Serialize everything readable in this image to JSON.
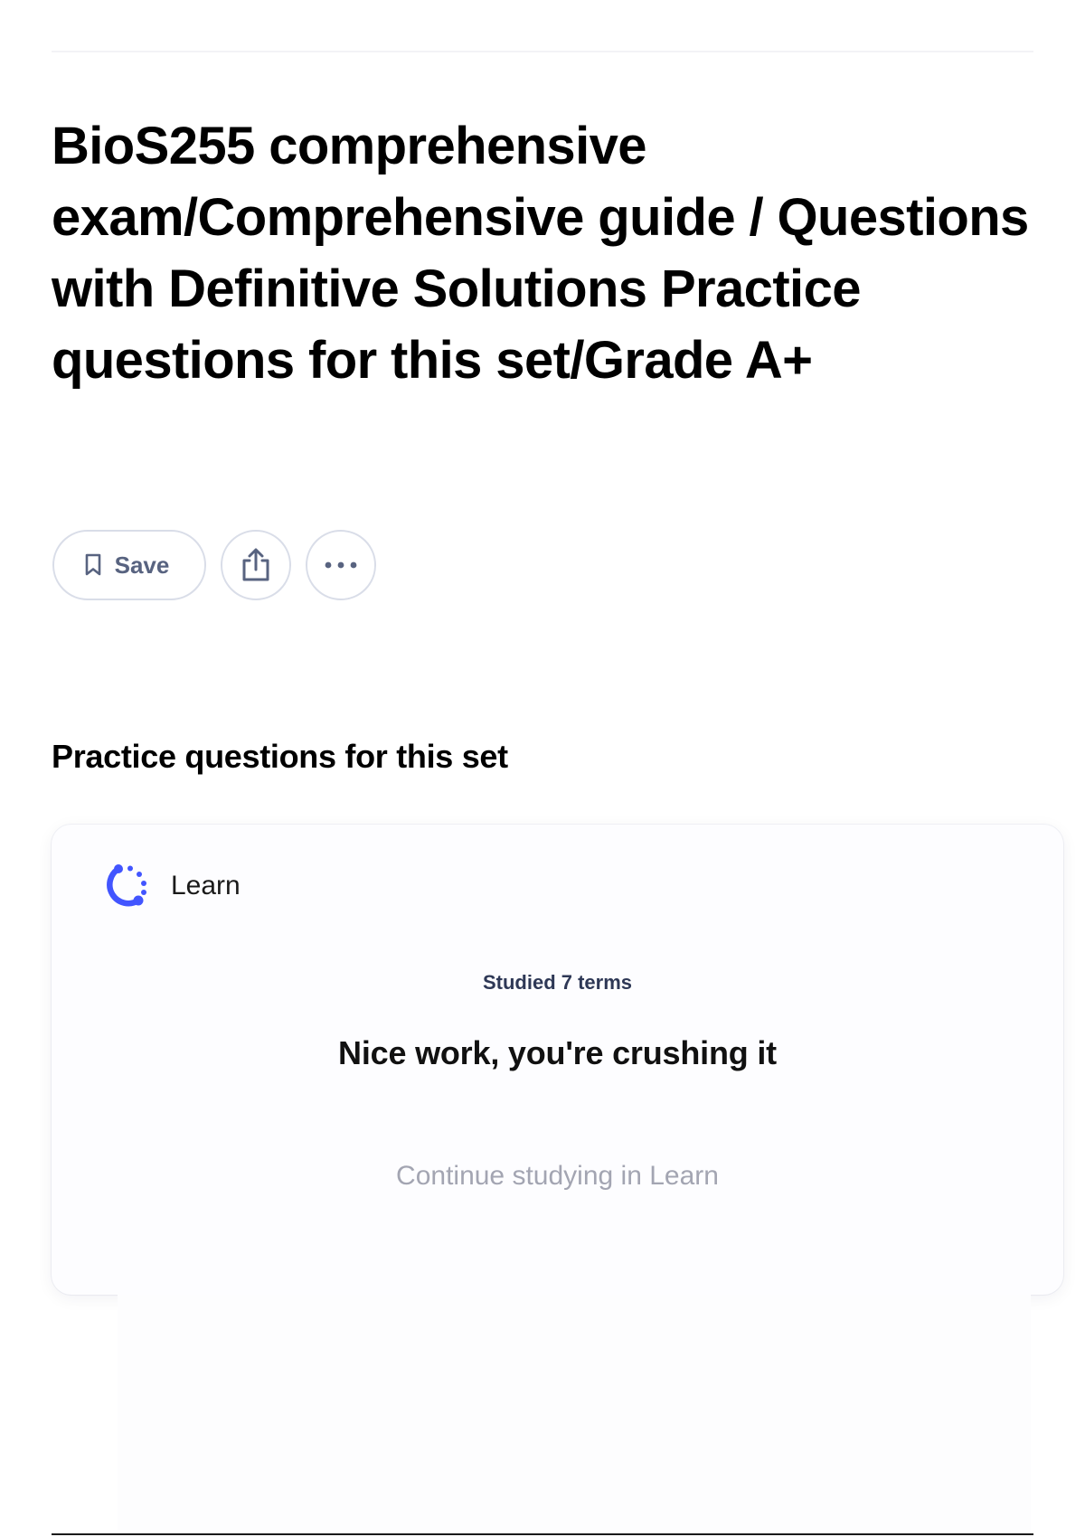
{
  "set": {
    "title": "BioS255 comprehensive exam/Comprehensive guide  / Questions with Definitive Solutions Practice questions for this set/Grade A+"
  },
  "actions": {
    "save_label": "Save",
    "save_icon": "bookmark-icon",
    "share_icon": "share-icon",
    "more_icon": "more-horizontal-icon"
  },
  "practice": {
    "heading": "Practice questions for this set",
    "card": {
      "mode_label": "Learn",
      "mode_icon": "learn-progress-icon",
      "studied_text": "Studied 7 terms",
      "message": "Nice work, you're crushing it",
      "cta_label": "Continue studying in Learn"
    }
  },
  "colors": {
    "accent": "#4255ff",
    "muted_text": "#a3a5b2",
    "border": "#d9dde8"
  }
}
